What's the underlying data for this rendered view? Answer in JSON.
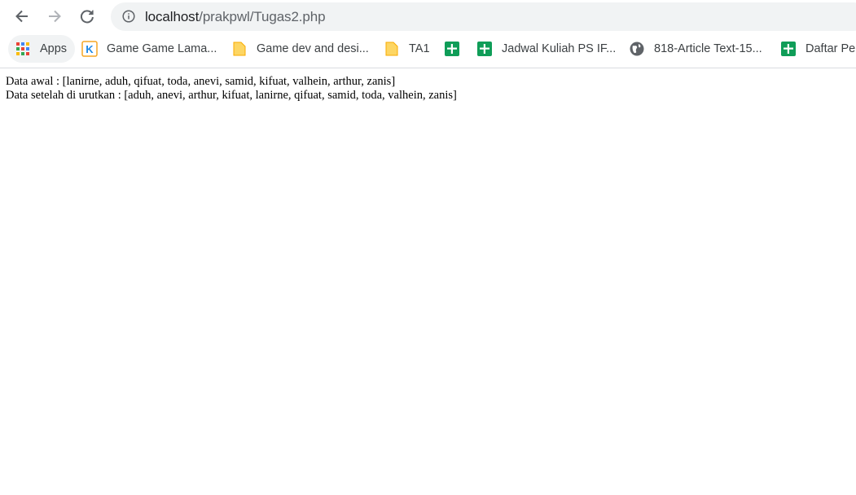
{
  "browser": {
    "url_host": "localhost",
    "url_path": "/prakpwl/Tugas2.php",
    "bookmarks": [
      {
        "label": "Apps",
        "icon": "apps-grid-icon"
      },
      {
        "label": "Game Game Lama...",
        "icon": "kaskus-icon"
      },
      {
        "label": "Game dev and desi...",
        "icon": "folder-icon"
      },
      {
        "label": "TA1",
        "icon": "folder-icon"
      },
      {
        "label": "",
        "icon": "google-sheets-icon"
      },
      {
        "label": "Jadwal Kuliah PS IF...",
        "icon": "google-sheets-icon"
      },
      {
        "label": "818-Article Text-15...",
        "icon": "globe-icon"
      },
      {
        "label": "Daftar Pe",
        "icon": "google-sheets-icon"
      }
    ]
  },
  "page": {
    "line1": "Data awal : [lanirne, aduh, qifuat, toda, anevi, samid, kifuat, valhein, arthur, zanis]",
    "line2": "Data setelah di urutkan : [aduh, anevi, arthur, kifuat, lanirne, qifuat, samid, toda, valhein, zanis]"
  }
}
